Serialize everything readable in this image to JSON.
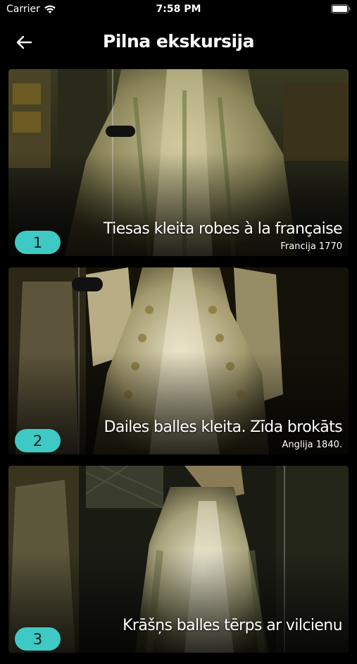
{
  "status_bar": {
    "carrier": "Carrier",
    "time": "7:58 PM"
  },
  "nav": {
    "title": "Pilna ekskursija",
    "back_icon": "arrow-left-icon"
  },
  "colors": {
    "background": "#000000",
    "badge": "#3ec9c4"
  },
  "items": [
    {
      "number": "1",
      "title": "Tiesas kleita robes à la française",
      "subtitle": "Francija 1770"
    },
    {
      "number": "2",
      "title": "Dailes balles kleita. Zīda brokāts",
      "subtitle": "Anglija 1840."
    },
    {
      "number": "3",
      "title": "Krāšņs balles tērps ar vilcienu",
      "subtitle": ""
    }
  ]
}
